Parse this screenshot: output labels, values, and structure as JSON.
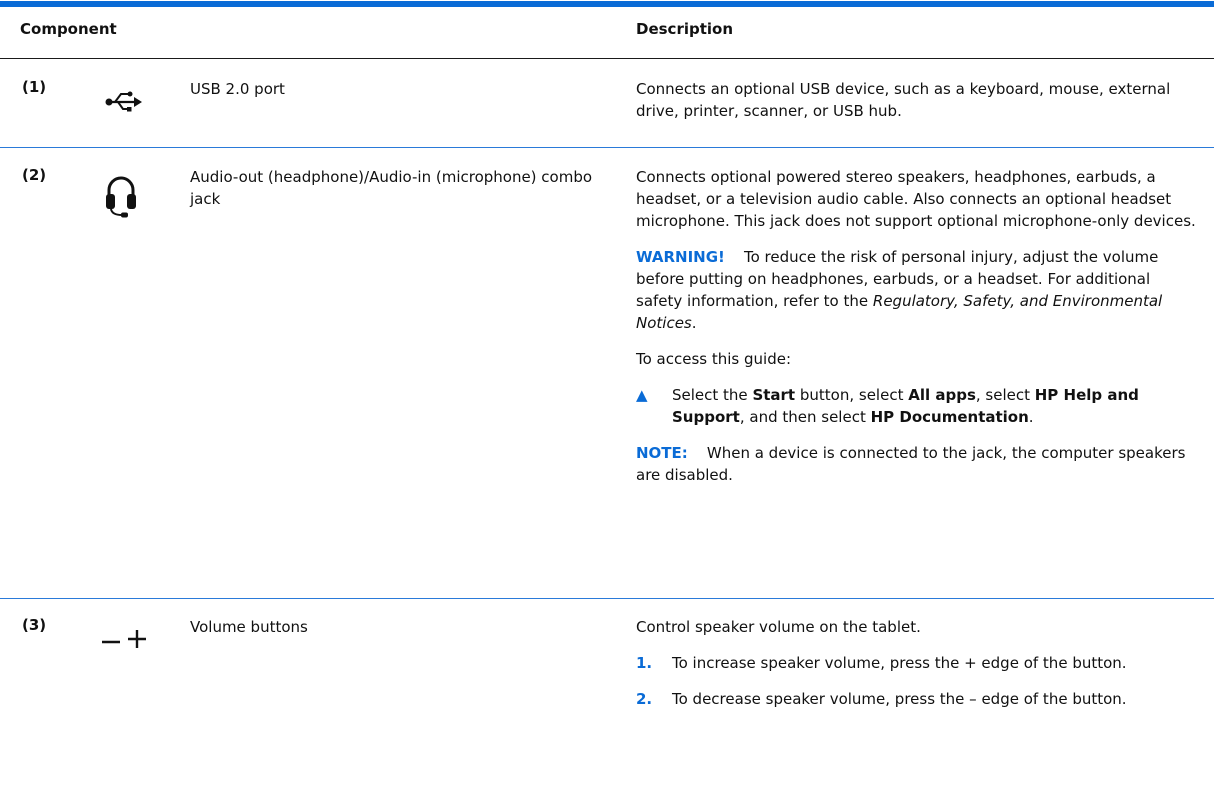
{
  "header": {
    "component_label": "Component",
    "description_label": "Description"
  },
  "rows": [
    {
      "num": "(1)",
      "icon": "usb-icon",
      "name": "USB 2.0 port",
      "desc": "Connects an optional USB device, such as a keyboard, mouse, external drive, printer, scanner, or USB hub."
    },
    {
      "num": "(2)",
      "icon": "headset-icon",
      "name": "Audio-out (headphone)/Audio-in (microphone) combo jack",
      "desc": "Connects optional powered stereo speakers, headphones, earbuds, a headset, or a television audio cable. Also connects an optional headset microphone. This jack does not support optional microphone-only devices.",
      "warning_label": "WARNING!",
      "warning_text": "To reduce the risk of personal injury, adjust the volume before putting on headphones, earbuds, or a headset. For additional safety information, refer to the",
      "warning_doc": "Regulatory, Safety, and Environmental Notices",
      "warning_end": ".",
      "access_text": "To access this guide:",
      "bullet_marker": "▲",
      "bullet_parts": {
        "p1": "Select the ",
        "b1": "Start",
        "p2": " button, select ",
        "b2": "All apps",
        "p3": ", select ",
        "b3": "HP Help and Support",
        "p4": ", and then select ",
        "b4": "HP Documentation",
        "p5": "."
      },
      "note_label": "NOTE:",
      "note_text": "When a device is connected to the jack, the computer speakers are disabled."
    },
    {
      "num": "(3)",
      "icon": "volume-minus-plus-icon",
      "name": "Volume buttons",
      "desc": "Control speaker volume on the tablet.",
      "steps": [
        {
          "n": "1.",
          "text": "To increase speaker volume, press the + edge of the button."
        },
        {
          "n": "2.",
          "text": "To decrease speaker volume, press the – edge of the button."
        }
      ]
    }
  ],
  "colors": {
    "accent": "#0a6bd6"
  }
}
